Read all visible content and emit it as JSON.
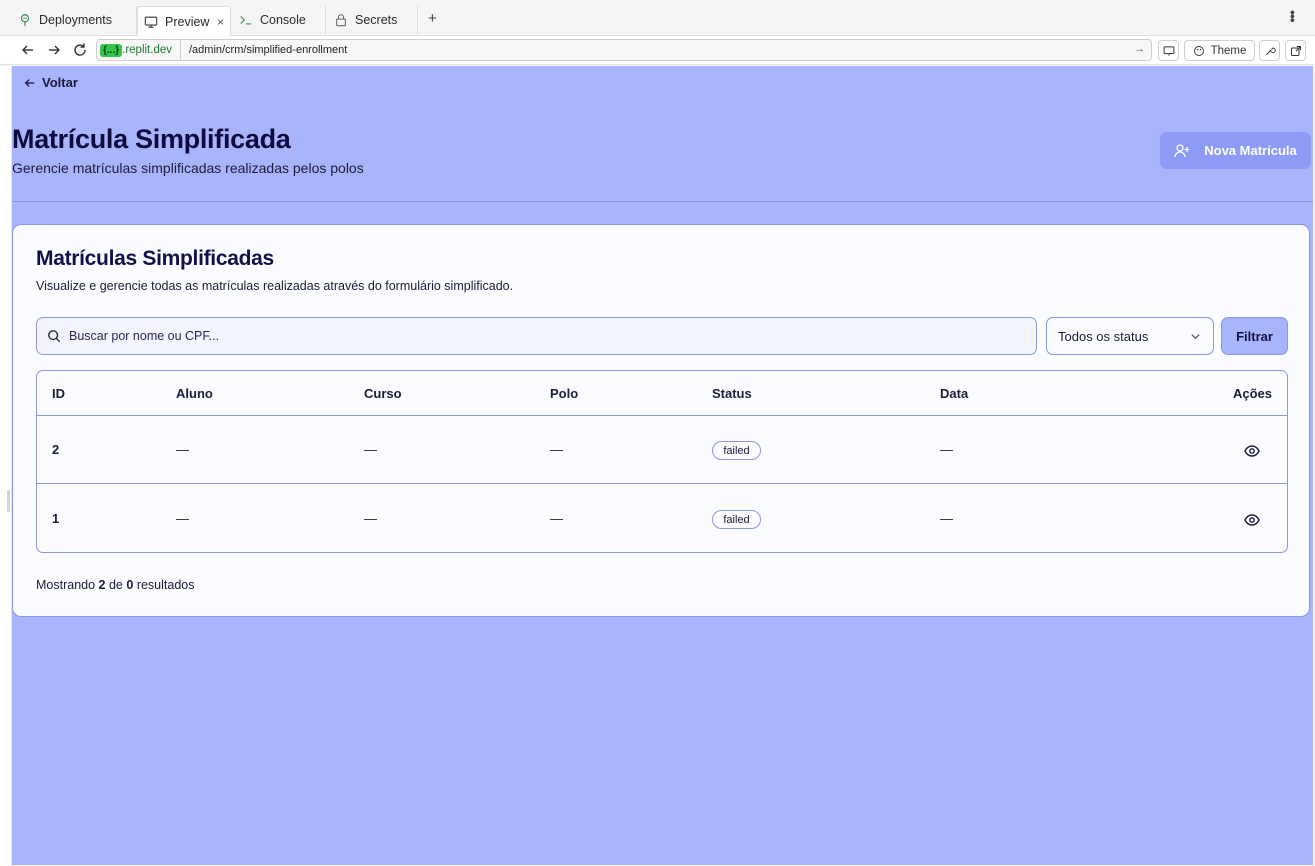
{
  "ide": {
    "tabs": [
      {
        "label": "Deployments",
        "icon": "deployments-icon"
      },
      {
        "label": "Preview",
        "icon": "monitor-icon",
        "active": true
      },
      {
        "label": "Console",
        "icon": "terminal-icon"
      },
      {
        "label": "Secrets",
        "icon": "lock-icon"
      }
    ],
    "new_tab_label": "+",
    "close_label": "×"
  },
  "addressbar": {
    "domain_badge": "{...}",
    "domain": ".replit.dev",
    "path": "/admin/crm/simplified-enrollment",
    "theme_label": "Theme"
  },
  "page": {
    "back_label": "Voltar",
    "title": "Matrícula Simplificada",
    "subtitle": "Gerencie matrículas simplificadas realizadas pelos polos",
    "new_button_label": "Nova Matrícula"
  },
  "card": {
    "title": "Matrículas Simplificadas",
    "description": "Visualize e gerencie todas as matrículas realizadas através do formulário simplificado.",
    "search_placeholder": "Buscar por nome ou CPF...",
    "status_filter_value": "Todos os status",
    "filter_button_label": "Filtrar"
  },
  "table": {
    "columns": [
      "ID",
      "Aluno",
      "Curso",
      "Polo",
      "Status",
      "Data",
      "Ações"
    ],
    "rows": [
      {
        "id": "2",
        "aluno": "—",
        "curso": "—",
        "polo": "—",
        "status": "failed",
        "data": "—"
      },
      {
        "id": "1",
        "aluno": "—",
        "curso": "—",
        "polo": "—",
        "status": "failed",
        "data": "—"
      }
    ]
  },
  "footer": {
    "prefix": "Mostrando",
    "shown": "2",
    "middle": "de",
    "total": "0",
    "suffix": "resultados"
  },
  "colors": {
    "viewport_bg": "#a8b5fd",
    "card_bg": "#fbfcff",
    "border": "#8a96e6",
    "primary_button": "#8e9bf6",
    "title_text": "#0f0c3d"
  }
}
